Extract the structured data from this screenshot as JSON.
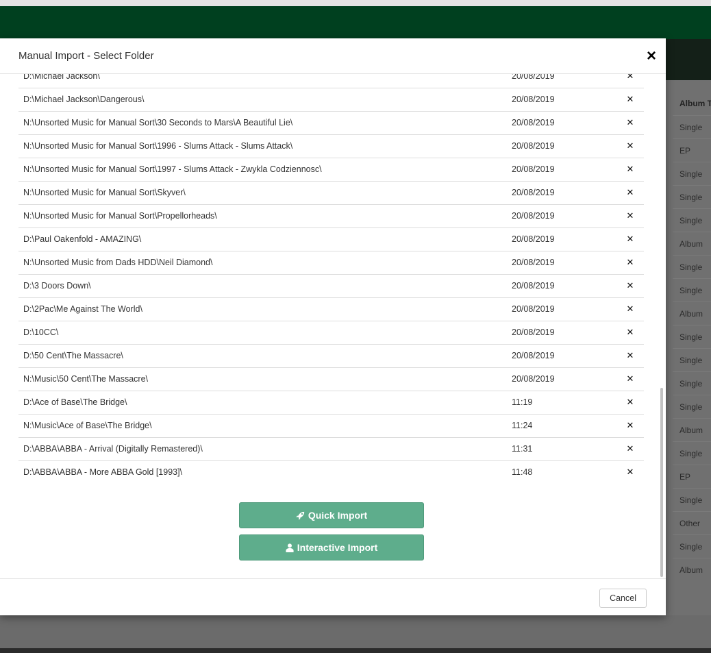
{
  "modal": {
    "title": "Manual Import - Select Folder",
    "close_symbol": "×",
    "remove_symbol": "✕",
    "folders": [
      {
        "path": "D:\\Michael Jackson\\",
        "date": "20/08/2019"
      },
      {
        "path": "D:\\Michael Jackson\\Dangerous\\",
        "date": "20/08/2019"
      },
      {
        "path": "N:\\Unsorted Music for Manual Sort\\30 Seconds to Mars\\A Beautiful Lie\\",
        "date": "20/08/2019"
      },
      {
        "path": "N:\\Unsorted Music for Manual Sort\\1996 - Slums Attack - Slums Attack\\",
        "date": "20/08/2019"
      },
      {
        "path": "N:\\Unsorted Music for Manual Sort\\1997 - Slums Attack - Zwykla Codziennosc\\",
        "date": "20/08/2019"
      },
      {
        "path": "N:\\Unsorted Music for Manual Sort\\Skyver\\",
        "date": "20/08/2019"
      },
      {
        "path": "N:\\Unsorted Music for Manual Sort\\Propellorheads\\",
        "date": "20/08/2019"
      },
      {
        "path": "D:\\Paul Oakenfold - AMAZING\\",
        "date": "20/08/2019"
      },
      {
        "path": "N:\\Unsorted Music from Dads HDD\\Neil Diamond\\",
        "date": "20/08/2019"
      },
      {
        "path": "D:\\3 Doors Down\\",
        "date": "20/08/2019"
      },
      {
        "path": "D:\\2Pac\\Me Against The World\\",
        "date": "20/08/2019"
      },
      {
        "path": "D:\\10CC\\",
        "date": "20/08/2019"
      },
      {
        "path": "D:\\50 Cent\\The Massacre\\",
        "date": "20/08/2019"
      },
      {
        "path": "N:\\Music\\50 Cent\\The Massacre\\",
        "date": "20/08/2019"
      },
      {
        "path": "D:\\Ace of Base\\The Bridge\\",
        "date": "11:19"
      },
      {
        "path": "N:\\Music\\Ace of Base\\The Bridge\\",
        "date": "11:24"
      },
      {
        "path": "D:\\ABBA\\ABBA - Arrival (Digitally Remastered)\\",
        "date": "11:31"
      },
      {
        "path": "D:\\ABBA\\ABBA - More ABBA Gold [1993]\\",
        "date": "11:48"
      }
    ],
    "quick_import_label": "Quick Import",
    "interactive_import_label": "Interactive Import",
    "cancel_label": "Cancel"
  },
  "background": {
    "column_header": "Album T",
    "album_types": [
      "Single",
      "EP",
      "Single",
      "Single",
      "Single",
      "Album",
      "Single",
      "Single",
      "Album",
      "Single",
      "Single",
      "Single",
      "Single",
      "Album",
      "Single",
      "EP",
      "Single",
      "Other",
      "Single",
      "Album"
    ]
  },
  "colors": {
    "header_green": "#00401f",
    "button_green": "#5ead8c"
  },
  "icons": {
    "quick_import": "rocket-icon",
    "interactive_import": "user-icon",
    "remove": "close-icon"
  }
}
